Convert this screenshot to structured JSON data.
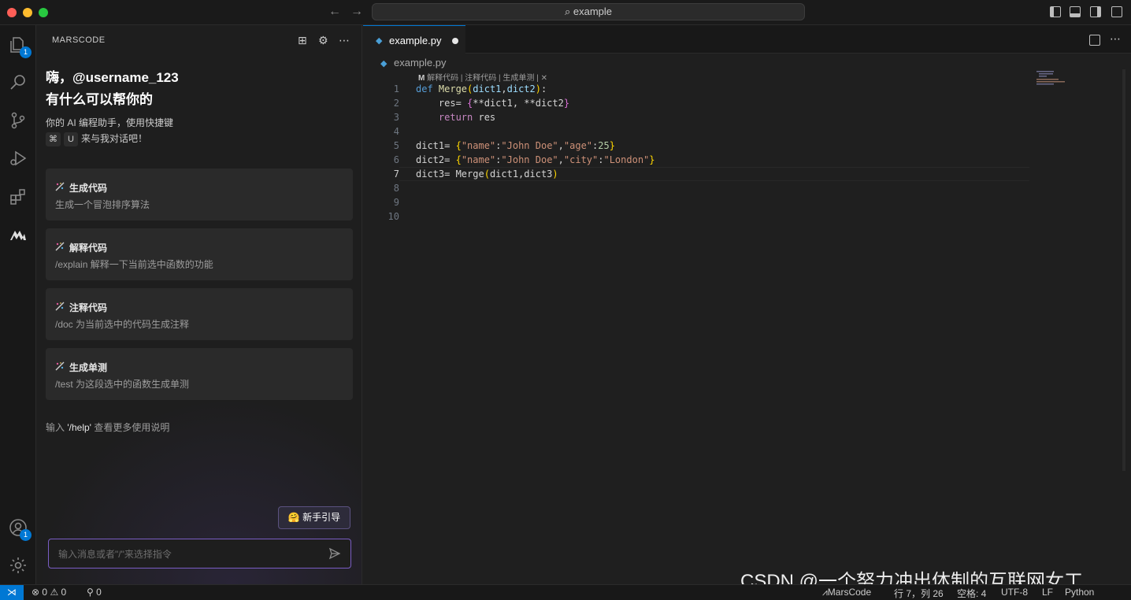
{
  "titlebar": {
    "search": "example"
  },
  "activity": {
    "explorer_badge": "1",
    "account_badge": "1"
  },
  "sidebar": {
    "title": "MARSCODE",
    "greeting_line1": "嗨，@username_123",
    "greeting_line2": "有什么可以帮你的",
    "intro_line1": "你的 AI 编程助手，使用快捷键",
    "shortcut_key1": "⌘",
    "shortcut_key2": "U",
    "intro_line2": "来与我对话吧！",
    "cards": [
      {
        "title": "生成代码",
        "desc": "生成一个冒泡排序算法"
      },
      {
        "title": "解释代码",
        "desc": "/explain 解释一下当前选中函数的功能"
      },
      {
        "title": "注释代码",
        "desc": "/doc 为当前选中的代码生成注释"
      },
      {
        "title": "生成单测",
        "desc": "/test 为这段选中的函数生成单测"
      }
    ],
    "help_prefix": "输入",
    "help_cmd": "'/help'",
    "help_suffix": "查看更多使用说明",
    "guide_button": "🤗 新手引导",
    "input_placeholder": "输入消息或者\"/\"来选择指令"
  },
  "editor": {
    "tab_label": "example.py",
    "breadcrumb": "example.py",
    "codelens": "解释代码 | 注释代码 | 生成单测 | ✕",
    "line_numbers": [
      "1",
      "2",
      "3",
      "4",
      "5",
      "6",
      "7",
      "8",
      "9",
      "10"
    ],
    "current_line": "7"
  },
  "statusbar": {
    "problems": "0",
    "warnings": "0",
    "ports": "0",
    "marscode": "MarsCode",
    "position": "行 7，列 26",
    "spaces": "空格: 4",
    "encoding": "UTF-8",
    "eol": "LF",
    "language": "Python"
  },
  "watermark": "CSDN @一个努力冲出体制的互联网女工"
}
